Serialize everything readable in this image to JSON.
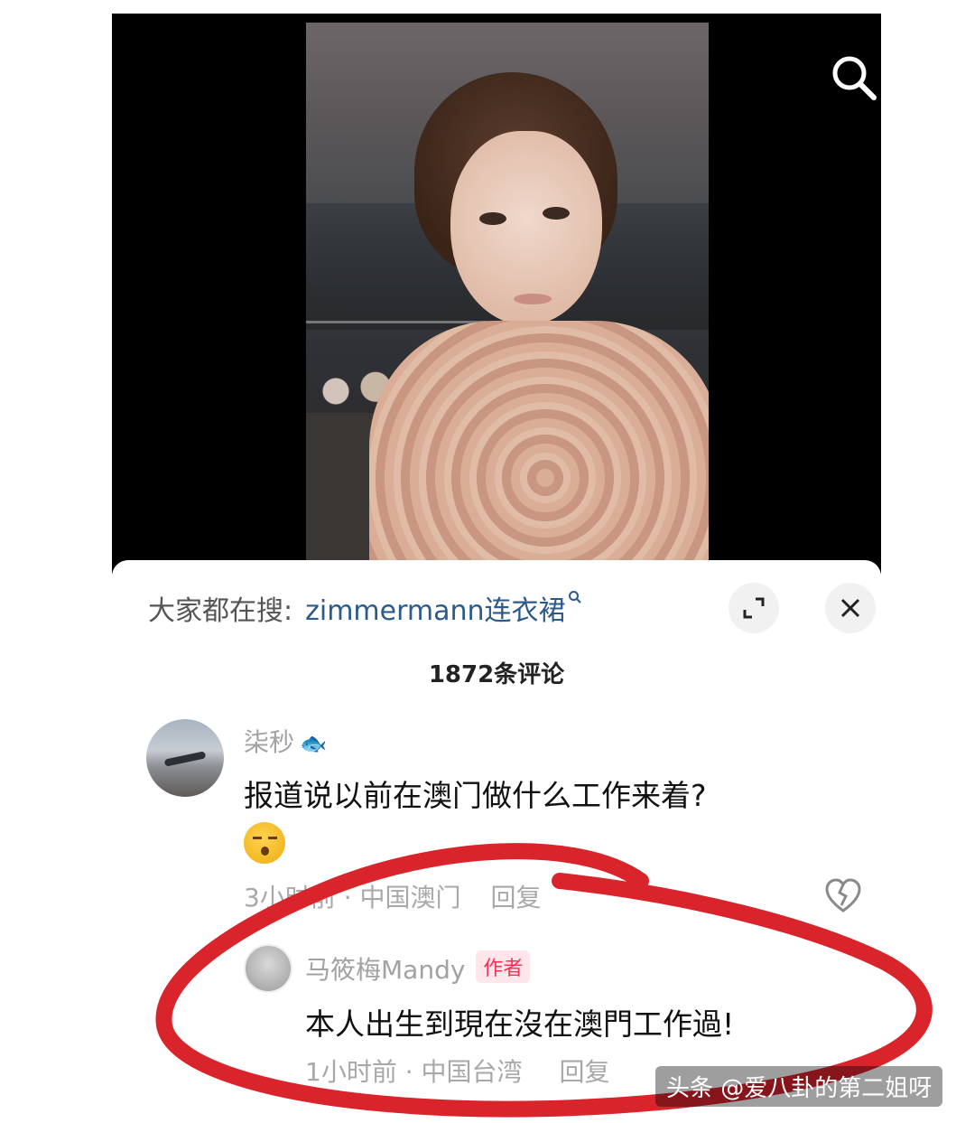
{
  "video": {
    "search_icon": "search-icon"
  },
  "comments_panel": {
    "trending_label": "大家都在搜:",
    "trending_query": "zimmermann连衣裙",
    "trending_icon": "search-small-icon",
    "expand_icon": "expand-icon",
    "close_icon": "close-icon",
    "comment_count": "1872条评论"
  },
  "comments": [
    {
      "username": "柒秒",
      "text": "报道说以前在澳门做什么工作来着?",
      "emoji": "huffing-face-emoji",
      "meta": "3小时前 · 中国澳门",
      "reply_label": "回复",
      "like_icon": "broken-heart-icon"
    },
    {
      "username": "马筱梅Mandy",
      "badge": "作者",
      "text": "本人出生到現在沒在澳門工作過!",
      "meta": "1小时前 · 中国台湾",
      "reply_label": "回复"
    }
  ],
  "watermark": "头条 @爱八卦的第二姐呀",
  "colors": {
    "annotation_ring": "#d9242c",
    "link": "#2b5a8b",
    "author_badge": "#ff2d55"
  }
}
